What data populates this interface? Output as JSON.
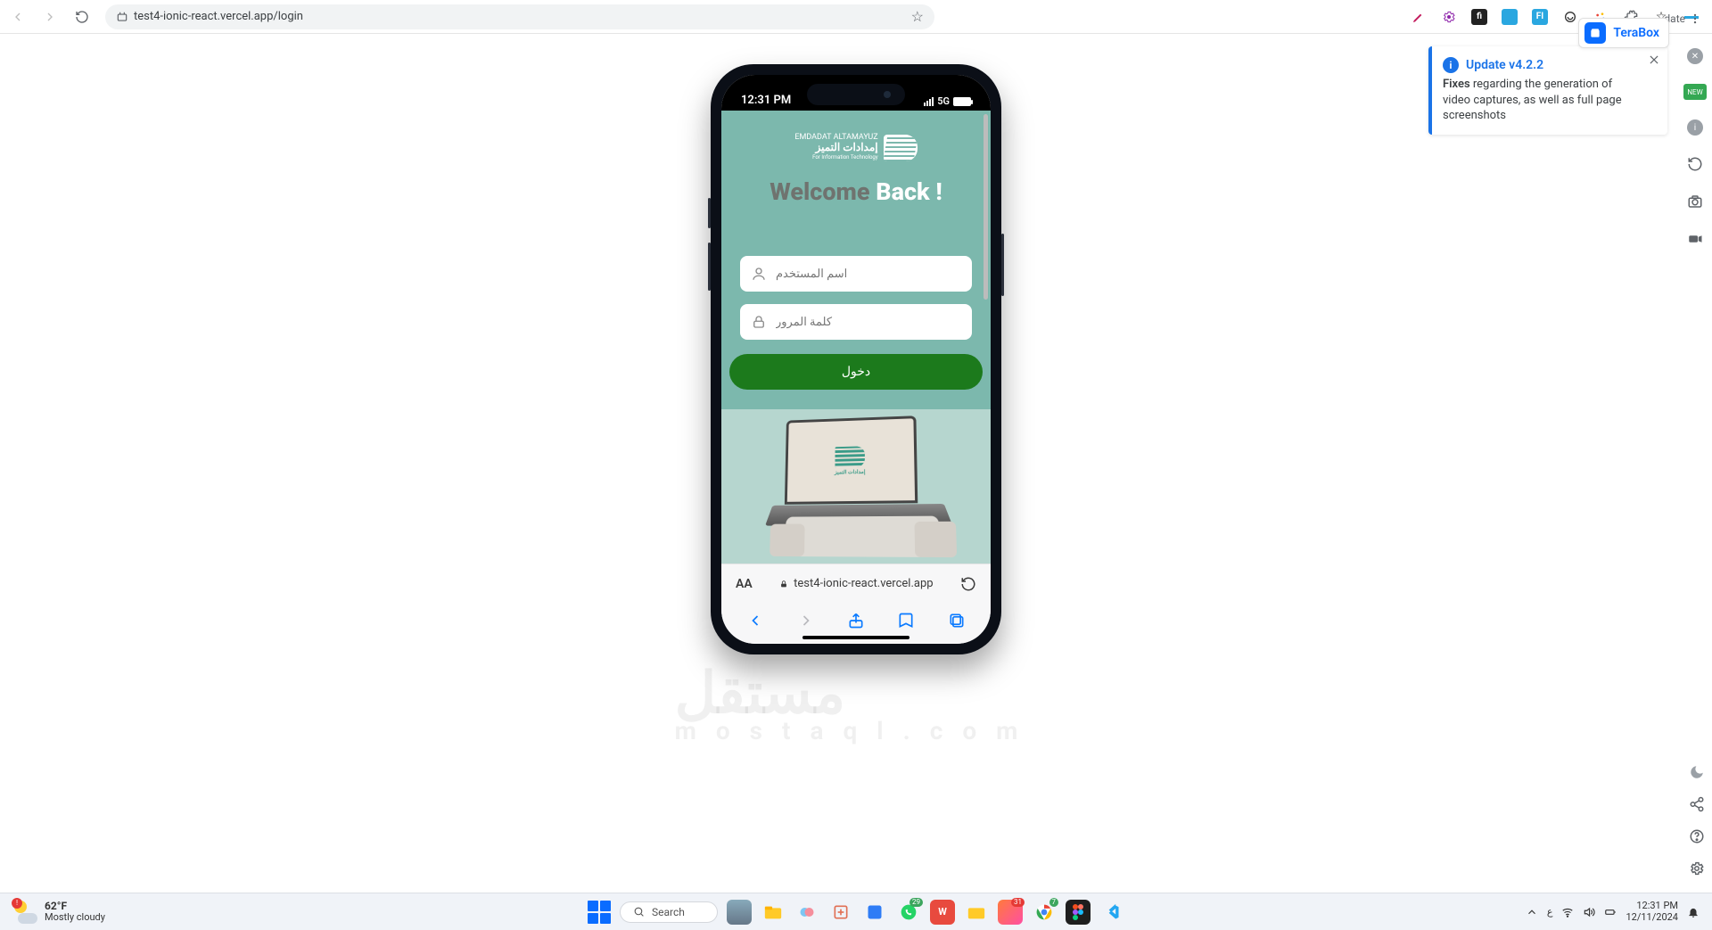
{
  "browser": {
    "url": "test4-ionic-react.vercel.app/login",
    "terabox": "TeraBox",
    "date_label": "date"
  },
  "notification": {
    "title": "Update v4.2.2",
    "fixes_label": "Fixes",
    "body_rest": " regarding the generation of video captures, as well as full page screenshots"
  },
  "phone": {
    "status_time": "12:31 PM",
    "network_label": "5G",
    "brand_line1": "EMDADAT ALTAMAYUZ",
    "brand_line2": "إمدادات التميز",
    "brand_line3": "For Information Technology",
    "welcome_1": "Welcome ",
    "welcome_2": "Back !",
    "username_placeholder": "اسم المستخدم",
    "password_placeholder": "كلمة المرور",
    "login_label": "دخول",
    "safari_url": "test4-ionic-react.vercel.app",
    "aa_label": "AA"
  },
  "taskbar": {
    "temp": "62°F",
    "cond": "Mostly cloudy",
    "search": "Search",
    "lang": "ع",
    "time": "12:31 PM",
    "date": "12/11/2024"
  },
  "watermark": {
    "big": "مستقل",
    "small": "mostaql.com"
  }
}
